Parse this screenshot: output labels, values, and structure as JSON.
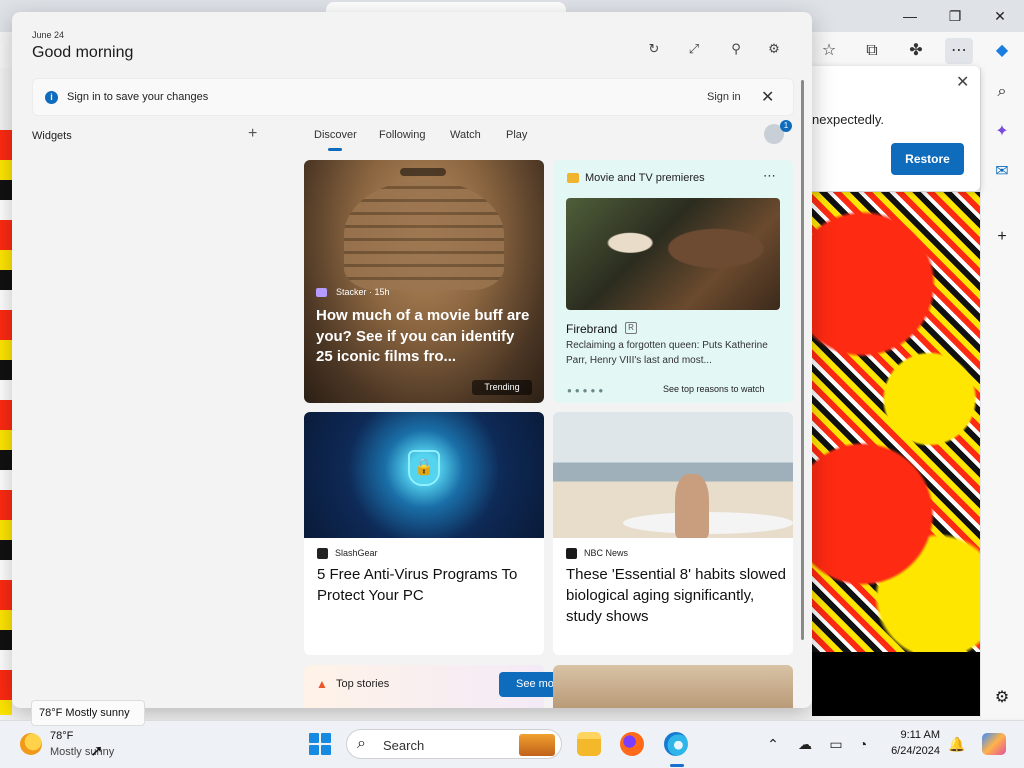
{
  "browser": {
    "restore_popup": {
      "message": "nexpectedly.",
      "button": "Restore"
    }
  },
  "widgets": {
    "date": "June 24",
    "greeting": "Good morning",
    "signin_bar": {
      "text": "Sign in to save your changes",
      "link": "Sign in"
    },
    "section_label": "Widgets",
    "tabs": [
      {
        "label": "Discover"
      },
      {
        "label": "Following"
      },
      {
        "label": "Watch"
      },
      {
        "label": "Play"
      }
    ],
    "avatar_badge": "1",
    "hero": {
      "source": "Stacker · 15h",
      "title": "How much of a movie buff are you? See if you can identify 25 iconic films fro...",
      "badge": "Trending"
    },
    "movie_card": {
      "heading": "Movie and TV premieres",
      "title": "Firebrand",
      "description": "Reclaiming a forgotten queen: Puts Katherine Parr, Henry VIII's last and most...",
      "link": "See top reasons to watch"
    },
    "news": [
      {
        "source": "SlashGear",
        "title": "5 Free Anti-Virus Programs To Protect Your PC",
        "icon_color": "#222222"
      },
      {
        "source": "NBC News",
        "title": "These 'Essential 8' habits slowed biological aging significantly, study shows",
        "icon_color": "#1a1a1a"
      }
    ],
    "top_stories": {
      "label": "Top stories",
      "see_more": "See more"
    }
  },
  "taskbar": {
    "weather_tooltip": "78°F Mostly sunny",
    "weather_temp": "78°F",
    "weather_desc": "Mostly sunny",
    "search_placeholder": "Search",
    "time": "9:11 AM",
    "date": "6/24/2024"
  },
  "colors": {
    "accent": "#0f6cbd",
    "panel_bg": "#f3f3f3"
  }
}
